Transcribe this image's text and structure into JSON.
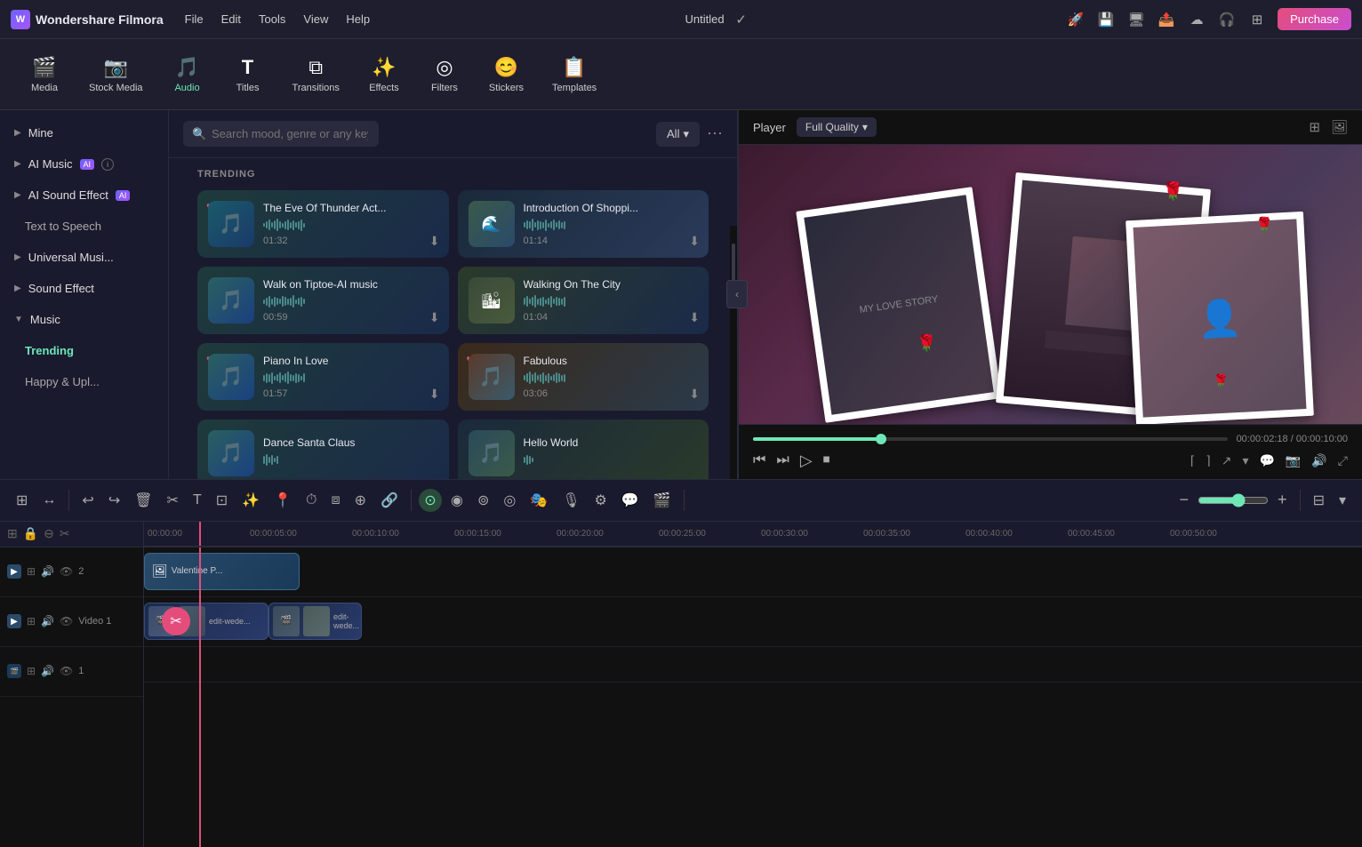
{
  "app": {
    "title": "Wondershare Filmora",
    "logo": "F"
  },
  "topbar": {
    "menu": [
      "File",
      "Edit",
      "Tools",
      "View",
      "Help"
    ],
    "project_title": "Untitled",
    "purchase_label": "Purchase"
  },
  "main_toolbar": {
    "items": [
      {
        "id": "media",
        "icon": "🎬",
        "label": "Media"
      },
      {
        "id": "stock_media",
        "icon": "📷",
        "label": "Stock Media"
      },
      {
        "id": "audio",
        "icon": "🎵",
        "label": "Audio"
      },
      {
        "id": "titles",
        "icon": "T",
        "label": "Titles"
      },
      {
        "id": "transitions",
        "icon": "▶",
        "label": "Transitions"
      },
      {
        "id": "effects",
        "icon": "✨",
        "label": "Effects"
      },
      {
        "id": "filters",
        "icon": "⭕",
        "label": "Filters"
      },
      {
        "id": "stickers",
        "icon": "😊",
        "label": "Stickers"
      },
      {
        "id": "templates",
        "icon": "📋",
        "label": "Templates"
      }
    ],
    "active": "audio"
  },
  "sidebar": {
    "items": [
      {
        "id": "mine",
        "label": "Mine",
        "arrow": "▶",
        "expanded": false
      },
      {
        "id": "ai_music",
        "label": "AI Music",
        "arrow": "▶",
        "expanded": false,
        "has_ai": true,
        "has_info": true
      },
      {
        "id": "ai_sound_effect",
        "label": "AI Sound Effect",
        "arrow": "▶",
        "expanded": true,
        "has_ai": true
      },
      {
        "id": "text_to_speech",
        "label": "Text to Speech",
        "sub": true
      },
      {
        "id": "universal_music",
        "label": "Universal Musi...",
        "arrow": "▶",
        "expanded": false
      },
      {
        "id": "sound_effect",
        "label": "Sound Effect",
        "arrow": "▶",
        "expanded": false
      },
      {
        "id": "music",
        "label": "Music",
        "arrow": "▼",
        "expanded": true
      },
      {
        "id": "trending",
        "label": "Trending",
        "sub": true,
        "active": true
      },
      {
        "id": "happy_upbeat",
        "label": "Happy & Upl...",
        "sub": true
      }
    ]
  },
  "search": {
    "placeholder": "Search mood, genre or any keyword",
    "filter_label": "All"
  },
  "trending": {
    "label": "TRENDING",
    "tracks": [
      {
        "id": 1,
        "name": "The Eve Of Thunder Act...",
        "duration": "01:32",
        "has_heart": true,
        "heart_color": "#e44d7b",
        "col": 0
      },
      {
        "id": 2,
        "name": "Introduction Of Shoppi...",
        "duration": "01:14",
        "has_heart": false,
        "col": 1
      },
      {
        "id": 3,
        "name": "Walk on Tiptoe-AI music",
        "duration": "00:59",
        "has_heart": false,
        "col": 0
      },
      {
        "id": 4,
        "name": "Walking On The City",
        "duration": "01:04",
        "has_heart": false,
        "col": 1
      },
      {
        "id": 5,
        "name": "Piano In Love",
        "duration": "01:57",
        "has_heart": true,
        "heart_color": "#e44d7b",
        "col": 0
      },
      {
        "id": 6,
        "name": "Fabulous",
        "duration": "03:06",
        "has_heart": true,
        "heart_color": "#e44d7b",
        "col": 1
      },
      {
        "id": 7,
        "name": "Dance Santa Claus",
        "duration": "",
        "has_heart": false,
        "col": 0
      },
      {
        "id": 8,
        "name": "Hello World",
        "duration": "",
        "has_heart": false,
        "col": 1
      }
    ]
  },
  "preview": {
    "label": "Player",
    "quality": "Full Quality",
    "current_time": "00:00:02:18",
    "total_time": "00:00:10:00",
    "progress_pct": 27
  },
  "timeline": {
    "ruler_marks": [
      "00:00:00",
      "00:00:05:00",
      "00:00:10:00",
      "00:00:15:00",
      "00:00:20:00",
      "00:00:25:00",
      "00:00:30:00",
      "00:00:35:00",
      "00:00:40:00",
      "00:00:45:00",
      "00:00:50:00"
    ],
    "tracks": [
      {
        "id": "track2",
        "label": "2",
        "type": "video",
        "clip_label": "Valentine P..."
      },
      {
        "id": "track1",
        "label": "Video 1",
        "type": "video",
        "clips": [
          "edit-wede...",
          "edit-wede..."
        ]
      }
    ]
  },
  "icons": {
    "search": "🔍",
    "download": "⬇",
    "heart": "♥",
    "play": "▶",
    "pause": "⏸",
    "stop": "⏹",
    "rewind": "⏮",
    "forward_frame": "⏭",
    "scissors": "✂",
    "undo": "↩",
    "redo": "↪",
    "delete": "🗑",
    "cut": "✂",
    "text": "T",
    "crop": "⊡",
    "more": "⋯",
    "chevron_down": "▾",
    "grid": "⊞",
    "image": "🖼"
  },
  "colors": {
    "accent_green": "#6ee7b7",
    "accent_pink": "#e44d7b",
    "bg_dark": "#1a1a2e",
    "bg_panel": "#1e1e2e",
    "bg_card": "#2a2a3e",
    "border": "#2a2a3e"
  }
}
